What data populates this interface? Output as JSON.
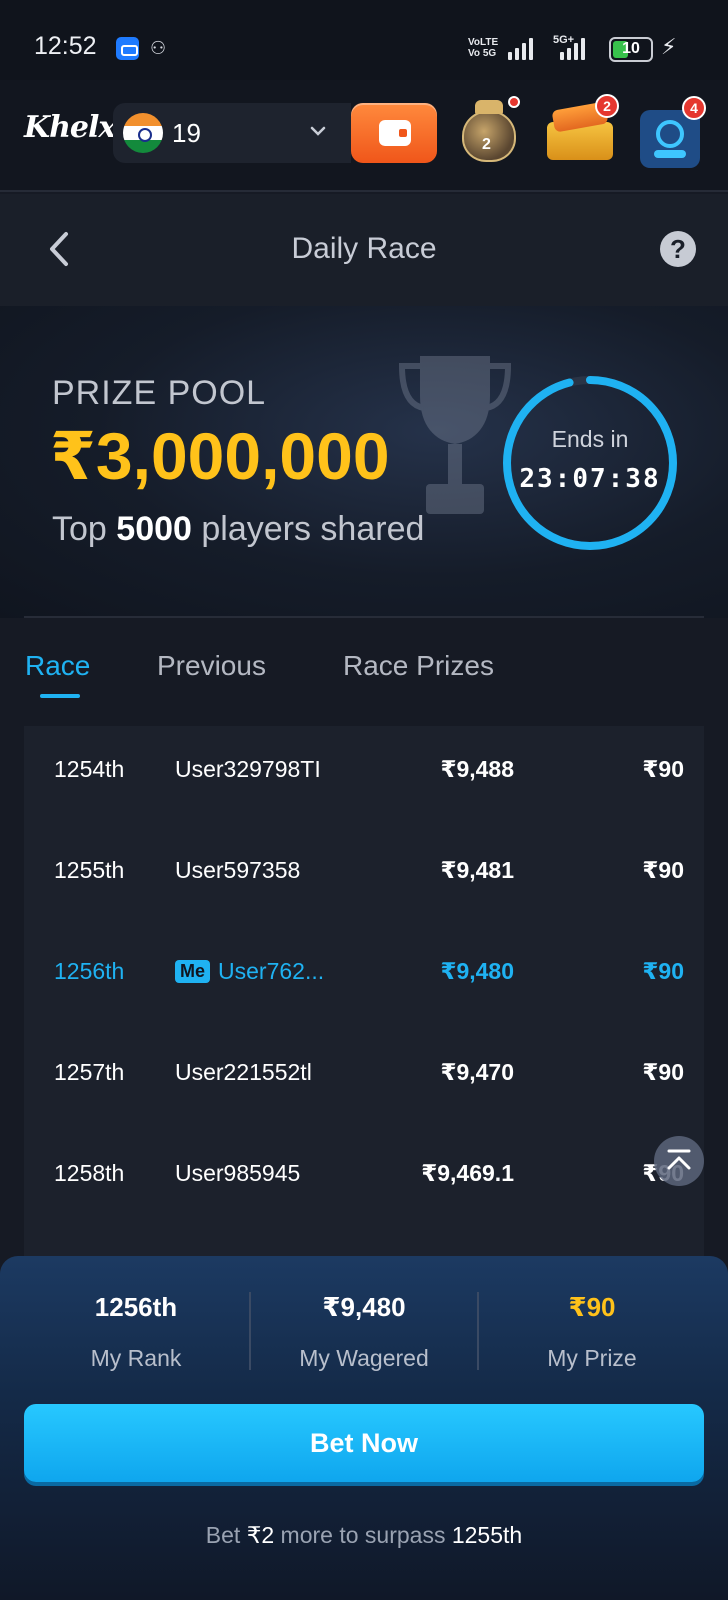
{
  "status_bar": {
    "time": "12:52",
    "volte": "VoLTE\nVo 5G",
    "network": "5G+",
    "battery": "10"
  },
  "header": {
    "logo": "Khelx",
    "balance": "19",
    "jar_level": "2",
    "gift_badge": "2",
    "support_badge": "4"
  },
  "title_bar": {
    "title": "Daily Race"
  },
  "hero": {
    "prize_label": "PRIZE POOL",
    "prize_amount": "₹3,000,000",
    "sub_prefix": "Top",
    "sub_count": "5000",
    "sub_suffix": "players shared",
    "countdown_label": "Ends in",
    "countdown_time": "23:07:38",
    "countdown_progress": 0.96
  },
  "tabs": [
    {
      "label": "Race",
      "active": true
    },
    {
      "label": "Previous",
      "active": false
    },
    {
      "label": "Race Prizes",
      "active": false
    }
  ],
  "leaderboard": [
    {
      "rank": "1254th",
      "user": "User329798TI",
      "wagered": "₹9,488",
      "prize": "₹90",
      "me": false
    },
    {
      "rank": "1255th",
      "user": "User597358",
      "wagered": "₹9,481",
      "prize": "₹90",
      "me": false
    },
    {
      "rank": "1256th",
      "user": "User762...",
      "wagered": "₹9,480",
      "prize": "₹90",
      "me": true,
      "me_label": "Me"
    },
    {
      "rank": "1257th",
      "user": "User221552tl",
      "wagered": "₹9,470",
      "prize": "₹90",
      "me": false
    },
    {
      "rank": "1258th",
      "user": "User985945",
      "wagered": "₹9,469.1",
      "prize": "₹90",
      "me": false
    }
  ],
  "summary": {
    "rank_value": "1256th",
    "rank_label": "My Rank",
    "wagered_value": "₹9,480",
    "wagered_label": "My Wagered",
    "prize_value": "₹90",
    "prize_label": "My Prize"
  },
  "bet_button": "Bet Now",
  "bet_hint": {
    "prefix": "Bet",
    "amount": "₹2",
    "middle": "more to surpass",
    "target": "1255th"
  },
  "colors": {
    "accent": "#1fb2f2",
    "gold": "#ffc21a",
    "wallet": "#f0561a",
    "background": "#161a24"
  }
}
